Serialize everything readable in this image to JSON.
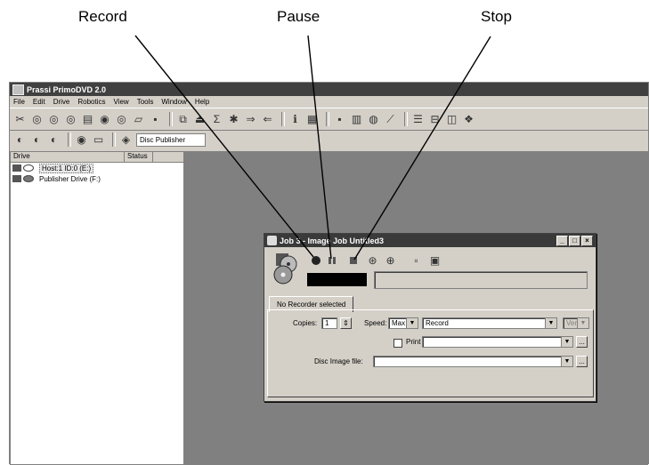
{
  "callouts": {
    "record": "Record",
    "pause": "Pause",
    "stop": "Stop"
  },
  "app": {
    "title": "Prassi PrimoDVD 2.0",
    "menu": [
      "File",
      "Edit",
      "Drive",
      "Robotics",
      "View",
      "Tools",
      "Window",
      "Help"
    ],
    "publisher_field": "Disc Publisher"
  },
  "drives": {
    "columns": [
      "Drive",
      "Status"
    ],
    "items": [
      {
        "name": "Host:1 ID:0 (E:)"
      },
      {
        "name": "Publisher Drive (F:)"
      }
    ]
  },
  "dialog": {
    "title": "Job 3 - Image Job Untitled3",
    "window_buttons": [
      "_",
      "□",
      "×"
    ],
    "tab_label": "No Recorder selected",
    "copies_label": "Copies:",
    "copies_value": "1",
    "speed_label": "Speed:",
    "speed_value": "Max",
    "mode_value": "Record",
    "verify_label": "Verif",
    "print_label": "Print",
    "disc_image_label": "Disc Image file:",
    "browse": "..."
  }
}
